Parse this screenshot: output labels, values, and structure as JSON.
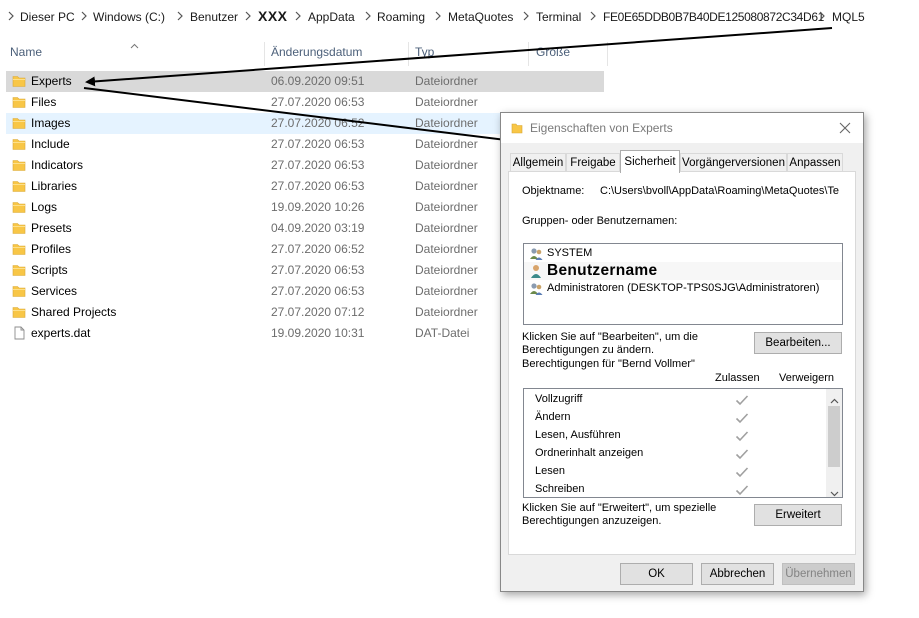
{
  "breadcrumb": {
    "items": [
      "Dieser PC",
      "Windows  (C:)",
      "Benutzer",
      "XXX",
      "AppData",
      "Roaming",
      "MetaQuotes",
      "Terminal",
      "FE0E65DDB0B7B40DE125080872C34D61",
      "MQL5"
    ]
  },
  "columns": {
    "name": "Name",
    "date": "Änderungsdatum",
    "type": "Typ",
    "size": "Größe"
  },
  "files": [
    {
      "name": "Experts",
      "date": "06.09.2020 09:51",
      "type": "Dateiordner",
      "icon": "folder-icon"
    },
    {
      "name": "Files",
      "date": "27.07.2020 06:53",
      "type": "Dateiordner",
      "icon": "folder-icon"
    },
    {
      "name": "Images",
      "date": "27.07.2020 06:52",
      "type": "Dateiordner",
      "icon": "folder-icon"
    },
    {
      "name": "Include",
      "date": "27.07.2020 06:53",
      "type": "Dateiordner",
      "icon": "folder-icon"
    },
    {
      "name": "Indicators",
      "date": "27.07.2020 06:53",
      "type": "Dateiordner",
      "icon": "folder-icon"
    },
    {
      "name": "Libraries",
      "date": "27.07.2020 06:53",
      "type": "Dateiordner",
      "icon": "folder-icon"
    },
    {
      "name": "Logs",
      "date": "19.09.2020 10:26",
      "type": "Dateiordner",
      "icon": "folder-icon"
    },
    {
      "name": "Presets",
      "date": "04.09.2020 03:19",
      "type": "Dateiordner",
      "icon": "folder-icon"
    },
    {
      "name": "Profiles",
      "date": "27.07.2020 06:52",
      "type": "Dateiordner",
      "icon": "folder-icon"
    },
    {
      "name": "Scripts",
      "date": "27.07.2020 06:53",
      "type": "Dateiordner",
      "icon": "folder-icon"
    },
    {
      "name": "Services",
      "date": "27.07.2020 06:53",
      "type": "Dateiordner",
      "icon": "folder-icon"
    },
    {
      "name": "Shared Projects",
      "date": "27.07.2020 07:12",
      "type": "Dateiordner",
      "icon": "folder-icon"
    },
    {
      "name": "experts.dat",
      "date": "19.09.2020 10:31",
      "type": "DAT-Datei",
      "icon": "file-icon"
    }
  ],
  "dialog": {
    "title": "Eigenschaften von Experts",
    "tabs": [
      "Allgemein",
      "Freigabe",
      "Sicherheit",
      "Vorgängerversionen",
      "Anpassen"
    ],
    "active_tab": "Sicherheit",
    "object_label": "Objektname:",
    "object_value": "C:\\Users\\bvoll\\AppData\\Roaming\\MetaQuotes\\Te",
    "groups_label": "Gruppen- oder Benutzernamen:",
    "principals": [
      {
        "name": "SYSTEM",
        "icon": "user-group-icon"
      },
      {
        "name": "Benutzername",
        "icon": "user-icon"
      },
      {
        "name": "Administratoren (DESKTOP-TPS0SJG\\Administratoren)",
        "icon": "user-group-icon"
      }
    ],
    "edit_hint_1": "Klicken Sie auf \"Bearbeiten\", um die",
    "edit_hint_2": "Berechtigungen zu ändern.",
    "edit_button": "Bearbeiten...",
    "perm_for": "Berechtigungen für \"Bernd Vollmer\"",
    "allow_header": "Zulassen",
    "deny_header": "Verweigern",
    "permissions": [
      "Vollzugriff",
      "Ändern",
      "Lesen, Ausführen",
      "Ordnerinhalt anzeigen",
      "Lesen",
      "Schreiben"
    ],
    "advanced_hint_1": "Klicken Sie auf \"Erweitert\", um spezielle",
    "advanced_hint_2": "Berechtigungen anzuzeigen.",
    "advanced_button": "Erweitert",
    "ok_button": "OK",
    "cancel_button": "Abbrechen",
    "apply_button": "Übernehmen"
  },
  "colors": {
    "folder": "#f8c646",
    "selection": "#d9d9d9",
    "hover": "#e5f3ff",
    "check": "#a0a0a0"
  }
}
